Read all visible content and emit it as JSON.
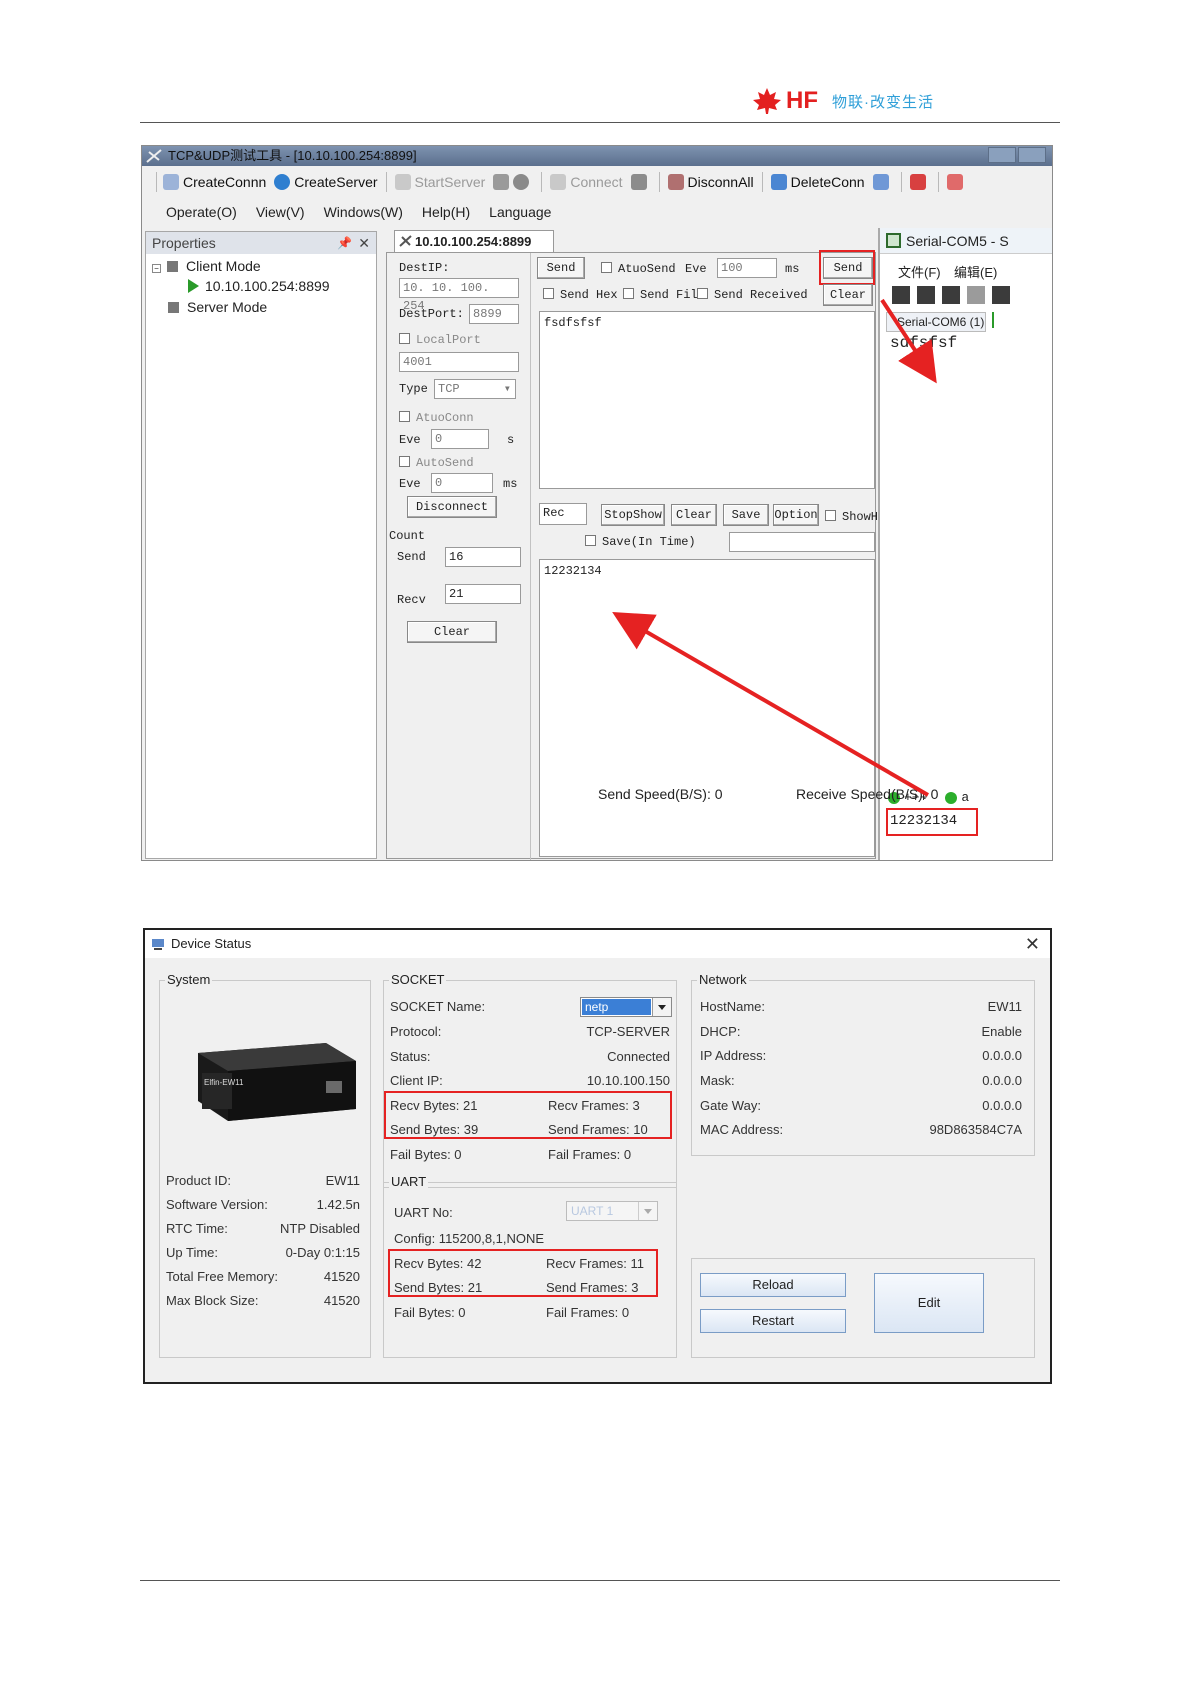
{
  "header": {
    "brand": "HF",
    "slogan": "物联·改变生活"
  },
  "tcp_tool": {
    "window_title": "TCP&UDP测试工具 - [10.10.100.254:8899]",
    "toolbar": [
      "CreateConnn",
      "CreateServer",
      "StartServer",
      "Connect",
      "DisconnAll",
      "DeleteConn"
    ],
    "menu": [
      "Operate(O)",
      "View(V)",
      "Windows(W)",
      "Help(H)",
      "Language"
    ],
    "properties": {
      "title": "Properties",
      "client_mode": "Client Mode",
      "connection": "10.10.100.254:8899",
      "server_mode": "Server Mode"
    },
    "tab_title": "10.10.100.254:8899",
    "conn_settings": {
      "dest_ip_label": "DestIP:",
      "dest_ip": "10. 10. 100. 254",
      "dest_port_label": "DestPort:",
      "dest_port": "8899",
      "local_port_label": "LocalPort",
      "local_port": "4001",
      "type_label": "Type",
      "type_value": "TCP",
      "auto_conn_label": "AtuoConn",
      "eve_label": "Eve",
      "eve_conn_value": "0",
      "eve_conn_unit": "s",
      "auto_send_label": "AutoSend",
      "eve_send_value": "0",
      "eve_send_unit": "ms",
      "disconnect_label": "Disconnect",
      "count_label": "Count",
      "send_label": "Send",
      "send_count": "16",
      "recv_label": "Recv",
      "recv_count": "21",
      "clear_label": "Clear"
    },
    "send_panel": {
      "send_button": "Send",
      "auto_send_label": "AtuoSend",
      "eve_label": "Eve",
      "eve_value": "100",
      "eve_unit": "ms",
      "send_button_2": "Send",
      "send_hex_label": "Send Hex",
      "send_file_label": "Send File",
      "send_received_label": "Send Received",
      "clear_button": "Clear",
      "send_text": "fsdfsfsf"
    },
    "recv_panel": {
      "rec_label": "Rec",
      "stopshow": "StopShow",
      "clear": "Clear",
      "save": "Save",
      "option": "Option",
      "show_hex": "ShowHe",
      "save_in_time": "Save(In Time)",
      "recv_text": "12232134"
    },
    "serial": {
      "title": "Serial-COM5 - S",
      "menu_file": "文件(F)",
      "menu_edit": "编辑(E)",
      "tab": "Serial-COM6 (1)",
      "received": "sdfsfsf",
      "cmd1": "+++",
      "cmd2": "a",
      "input_value": "12232134"
    },
    "status": {
      "send_speed": "Send Speed(B/S): 0",
      "recv_speed": "Receive Speed(B/S): 0"
    }
  },
  "device_status": {
    "title": "Device Status",
    "system": {
      "label": "System",
      "device_text_brand": "Elfin-EW11",
      "product_id_label": "Product ID:",
      "product_id": "EW11",
      "software_version_label": "Software Version:",
      "software_version": "1.42.5n",
      "rtc_time_label": "RTC Time:",
      "rtc_time": "NTP Disabled",
      "up_time_label": "Up Time:",
      "up_time": "0-Day 0:1:15",
      "total_free_memory_label": "Total Free Memory:",
      "total_free_memory": "41520",
      "max_block_size_label": "Max Block Size:",
      "max_block_size": "41520"
    },
    "socket": {
      "label": "SOCKET",
      "name_label": "SOCKET Name:",
      "name_value": "netp",
      "protocol_label": "Protocol:",
      "protocol": "TCP-SERVER",
      "status_label": "Status:",
      "status": "Connected",
      "client_ip_label": "Client IP:",
      "client_ip": "10.10.100.150",
      "recv_bytes": "Recv Bytes: 21",
      "recv_frames": "Recv Frames: 3",
      "send_bytes": "Send Bytes: 39",
      "send_frames": "Send Frames: 10",
      "fail_bytes": "Fail Bytes: 0",
      "fail_frames": "Fail Frames: 0"
    },
    "uart": {
      "label": "UART",
      "no_label": "UART No:",
      "no_value": "UART 1",
      "config": "Config: 115200,8,1,NONE",
      "recv_bytes": "Recv Bytes: 42",
      "recv_frames": "Recv Frames: 11",
      "send_bytes": "Send Bytes: 21",
      "send_frames": "Send Frames: 3",
      "fail_bytes": "Fail Bytes: 0",
      "fail_frames": "Fail Frames: 0"
    },
    "network": {
      "label": "Network",
      "hostname_label": "HostName:",
      "hostname": "EW11",
      "dhcp_label": "DHCP:",
      "dhcp": "Enable",
      "ip_label": "IP Address:",
      "ip": "0.0.0.0",
      "mask_label": "Mask:",
      "mask": "0.0.0.0",
      "gateway_label": "Gate Way:",
      "gateway": "0.0.0.0",
      "mac_label": "MAC Address:",
      "mac": "98D863584C7A"
    },
    "buttons": {
      "reload": "Reload",
      "restart": "Restart",
      "edit": "Edit"
    }
  }
}
